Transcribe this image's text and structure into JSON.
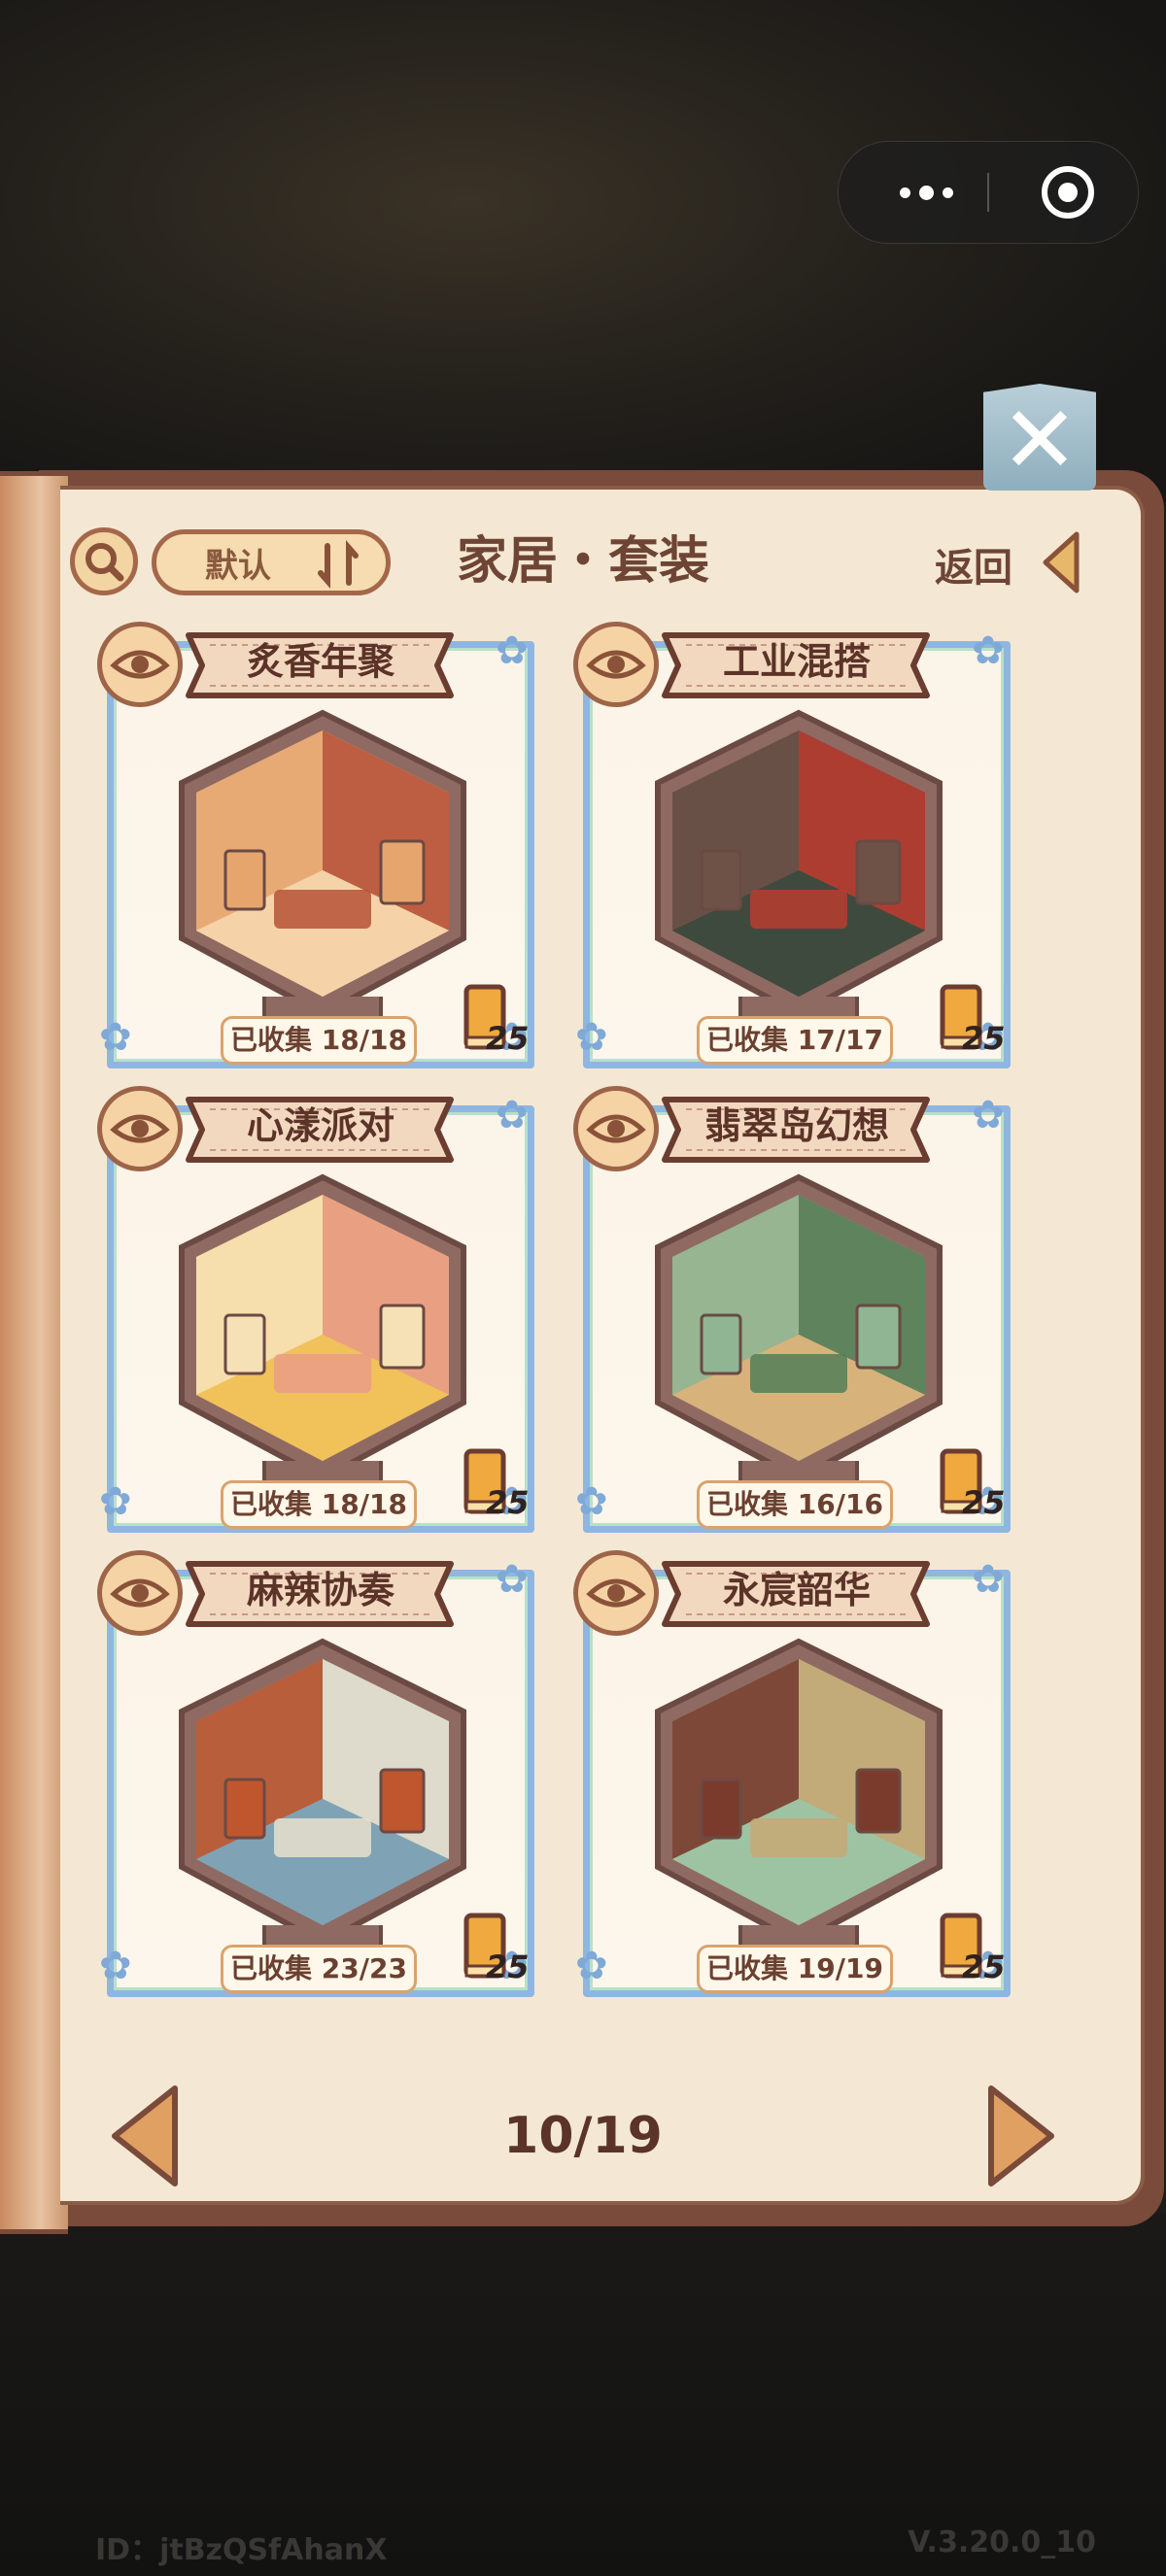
{
  "header": {
    "title": "家居・套装",
    "sort_label": "默认",
    "back_label": "返回",
    "close_glyph": "✕"
  },
  "cards": [
    {
      "name": "炙香年聚",
      "status": "已收集 18/18",
      "reward": "25",
      "palette": [
        "#e7a56e",
        "#b34a30",
        "#f6d2a8"
      ]
    },
    {
      "name": "工业混搭",
      "status": "已收集 17/17",
      "reward": "25",
      "palette": [
        "#6e5147",
        "#c23b2f",
        "#3f4a3e"
      ]
    },
    {
      "name": "心漾派对",
      "status": "已收集 18/18",
      "reward": "25",
      "palette": [
        "#f6e1b6",
        "#e89a8a",
        "#f1c15a"
      ]
    },
    {
      "name": "翡翠岛幻想",
      "status": "已收集 16/16",
      "reward": "25",
      "palette": [
        "#8fb592",
        "#4a7a57",
        "#d7b27a"
      ]
    },
    {
      "name": "麻辣协奏",
      "status": "已收集 23/23",
      "reward": "25",
      "palette": [
        "#c0562e",
        "#efe4d0",
        "#7fa3b5"
      ]
    },
    {
      "name": "永宸韶华",
      "status": "已收集 19/19",
      "reward": "25",
      "palette": [
        "#7a3b2c",
        "#c8a772",
        "#9ec3a2"
      ]
    }
  ],
  "pager": {
    "page": "10/19"
  },
  "footer": {
    "id": "ID：jtBzQSfAhanX",
    "version": "V.3.20.0_10"
  },
  "colors": {
    "accent": "#a5674a",
    "page": "#f4e8d4",
    "frame": "#8fb6e2"
  }
}
